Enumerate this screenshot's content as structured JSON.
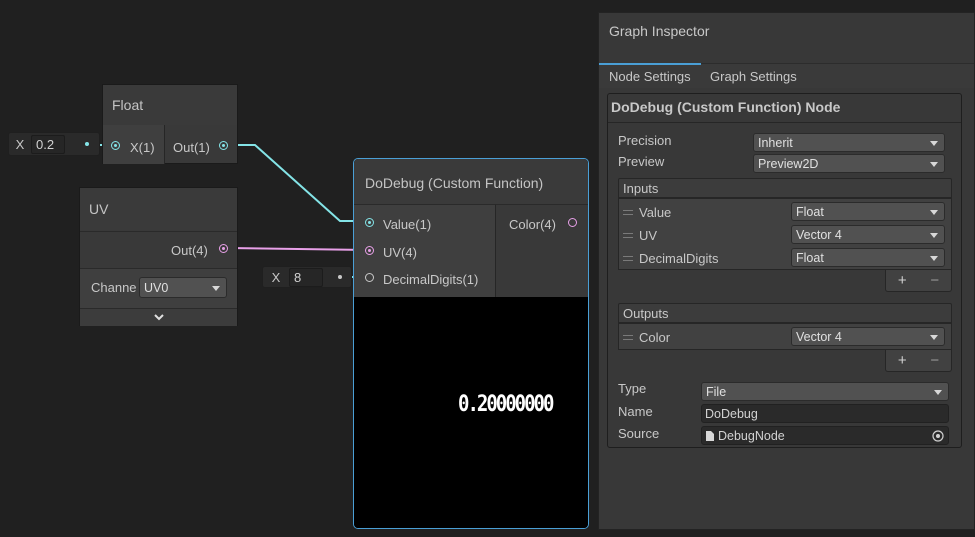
{
  "float_node": {
    "title": "Float",
    "input_label": "X(1)",
    "output_label": "Out(1)",
    "inline_axis": "X",
    "inline_value": "0.2"
  },
  "uv_node": {
    "title": "UV",
    "output_label": "Out(4)",
    "channel_label": "Channe",
    "channel_value": "UV0",
    "expand_glyph": "⌄"
  },
  "digits_inline": {
    "axis": "X",
    "value": "8"
  },
  "dodebug_node": {
    "title": "DoDebug (Custom Function)",
    "inputs": [
      "Value(1)",
      "UV(4)",
      "DecimalDigits(1)"
    ],
    "output_label": "Color(4)",
    "preview_text": "0.20000000"
  },
  "inspector": {
    "title": "Graph Inspector",
    "tabs": [
      "Node Settings",
      "Graph Settings"
    ],
    "active_tab": "Node Settings",
    "node_header": "DoDebug (Custom Function) Node",
    "precision_label": "Precision",
    "precision_value": "Inherit",
    "preview_label": "Preview",
    "preview_value": "Preview2D",
    "inputs_header": "Inputs",
    "inputs": [
      {
        "name": "Value",
        "type": "Float"
      },
      {
        "name": "UV",
        "type": "Vector 4"
      },
      {
        "name": "DecimalDigits",
        "type": "Float"
      }
    ],
    "outputs_header": "Outputs",
    "outputs": [
      {
        "name": "Color",
        "type": "Vector 4"
      }
    ],
    "plus_glyph": "+",
    "minus_glyph": "−",
    "type_label": "Type",
    "type_value": "File",
    "name_label": "Name",
    "name_value": "DoDebug",
    "source_label": "Source",
    "source_value": "DebugNode"
  },
  "colors": {
    "background": "#202020",
    "node": "#393939",
    "accent_cyan": "#84e4e7",
    "accent_pink": "#e8a0e8",
    "selection_blue": "#4a9fd6"
  }
}
